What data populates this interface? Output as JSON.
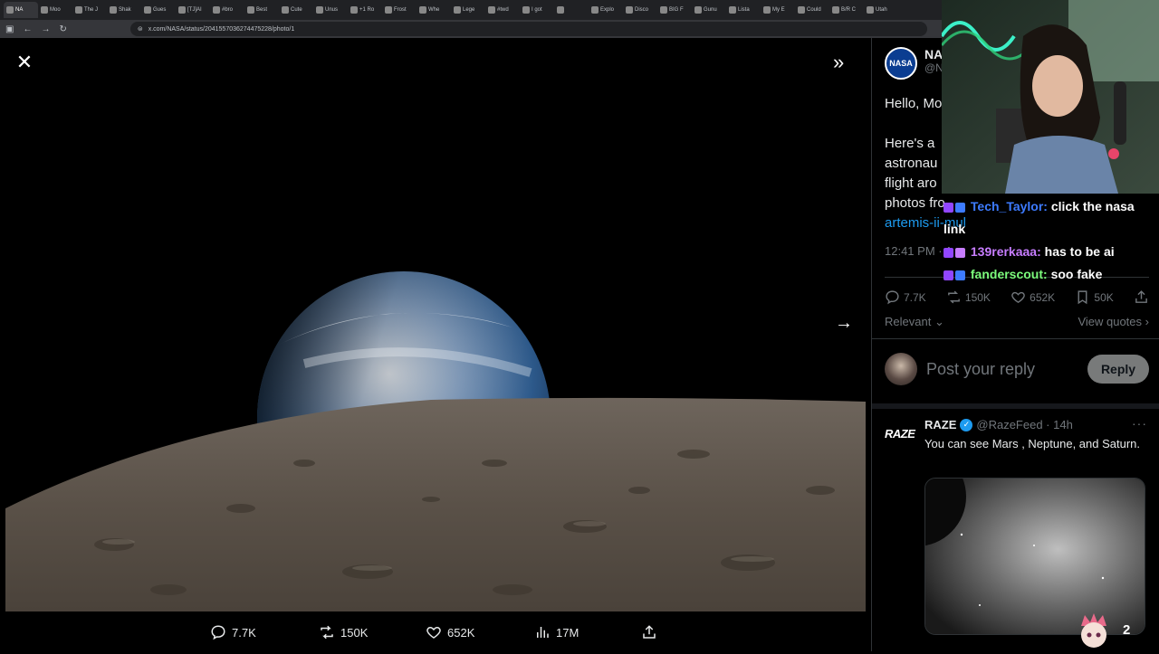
{
  "browser": {
    "tabs": [
      "NA",
      "Moo",
      "The J",
      "Shak",
      "Gues",
      "[TJ]AI",
      "#bro",
      "Best",
      "Cute",
      "Unus",
      "+1 Ro",
      "Frost",
      "Whe",
      "Lege",
      "#twd",
      "I got",
      "",
      "Explo",
      "Disco",
      "BIG F",
      "Gunu",
      "Lista",
      "My E",
      "Could",
      "B/R C",
      "Utah"
    ],
    "url": "x.com/NASA/status/2041557036274475228/photo/1"
  },
  "viewer": {
    "actions": {
      "replies": "7.7K",
      "reposts": "150K",
      "likes": "652K",
      "views": "17M"
    }
  },
  "tweet": {
    "author_short": "NA",
    "handle_short": "@N",
    "logo_text": "NASA",
    "text_lines": [
      "Hello, Mo",
      "",
      "Here's a",
      "astronau",
      "flight aro",
      "photos fro"
    ],
    "link_text": "artemis-ii-mul",
    "time": "12:41 PM · A",
    "stats": {
      "replies": "7.7K",
      "reposts": "150K",
      "likes": "652K",
      "bookmarks": "50K"
    },
    "filter_label": "Relevant",
    "view_quotes": "View quotes"
  },
  "reply_box": {
    "placeholder": "Post your reply",
    "button": "Reply"
  },
  "reply": {
    "logo": "RAZE",
    "name": "RAZE",
    "handle": "@RazeFeed · 14h",
    "text": "You can see Mars , Neptune, and Saturn."
  },
  "chat": [
    {
      "user": "Tech_Taylor:",
      "message": "click the nasa link"
    },
    {
      "user": "139rerkaaa:",
      "message": "has to be ai"
    },
    {
      "user": "fanderscout:",
      "message": "soo fake"
    }
  ],
  "overlay": {
    "count": "2"
  },
  "colors": {
    "accent": "#1d9bf0",
    "muted": "#71767b",
    "background": "#000000"
  }
}
